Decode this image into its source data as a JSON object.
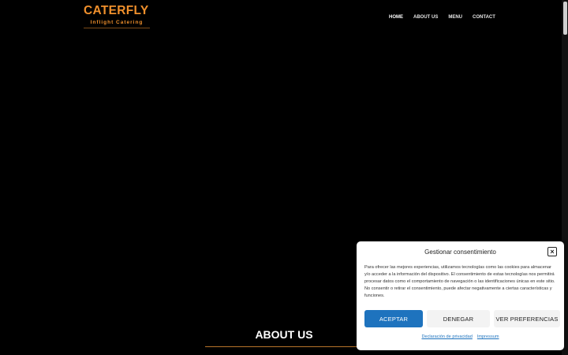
{
  "logo": {
    "title": "CATERFLY",
    "subtitle": "Inflight Catering"
  },
  "nav": {
    "items": [
      {
        "label": "HOME"
      },
      {
        "label": "ABOUT US"
      },
      {
        "label": "MENU"
      },
      {
        "label": "CONTACT"
      }
    ]
  },
  "about": {
    "heading": "ABOUT US"
  },
  "consent": {
    "title": "Gestionar consentimiento",
    "close_icon": "close-icon",
    "body": "Para ofrecer las mejores experiencias, utilizamos tecnologías como las cookies para almacenar y/o acceder a la información del dispositivo. El consentimiento de estas tecnologías nos permitirá procesar datos como el comportamiento de navegación o las identificaciones únicas en este sitio. No consentir o retirar el consentimiento, puede afectar negativamente a ciertas características y funciones.",
    "accept_label": "ACEPTAR",
    "deny_label": "DENEGAR",
    "prefs_label": "VER PREFERENCIAS",
    "privacy_link": "Declaración de privacidad",
    "impressum_link": "Impressum"
  },
  "colors": {
    "accent": "#f0902c",
    "button": "#1e73be"
  }
}
